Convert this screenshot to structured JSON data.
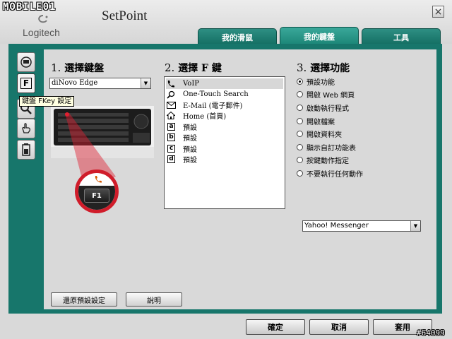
{
  "watermark": "MOBILE01",
  "post_id": "#64099",
  "brand": "Logitech",
  "app_title": "SetPoint",
  "close_glyph": "×",
  "tabs": [
    {
      "label": "我的滑鼠",
      "active": false
    },
    {
      "label": "我的鍵盤",
      "active": true
    },
    {
      "label": "工具",
      "active": false
    }
  ],
  "side_icons": [
    "keyboard-icon",
    "fkey-icon",
    "zoom-icon",
    "hand-icon",
    "battery-icon"
  ],
  "side_fkey_label": "F",
  "tooltip": "鍵盤 FKey 設定",
  "section1": {
    "num": "1.",
    "title": "選擇鍵盤"
  },
  "section2": {
    "num": "2.",
    "title": "選擇 F 鍵"
  },
  "section3": {
    "num": "3.",
    "title": "選擇功能"
  },
  "keyboard_select": {
    "value": "diNovo Edge"
  },
  "fkey_badge": "F1",
  "fkeys": [
    {
      "icon": "phone-icon",
      "glyph": "",
      "label": "VoIP",
      "selected": true
    },
    {
      "icon": "search-icon",
      "glyph": "",
      "label": "One-Touch Search",
      "selected": false
    },
    {
      "icon": "mail-icon",
      "glyph": "",
      "label": "E-Mail (電子郵件)",
      "selected": false
    },
    {
      "icon": "home-icon",
      "glyph": "",
      "label": "Home (首頁)",
      "selected": false
    },
    {
      "icon": "letter-a-icon",
      "glyph": "a",
      "label": "預設",
      "selected": false
    },
    {
      "icon": "letter-b-icon",
      "glyph": "b",
      "label": "預設",
      "selected": false
    },
    {
      "icon": "letter-c-icon",
      "glyph": "c",
      "label": "預設",
      "selected": false
    },
    {
      "icon": "letter-d-icon",
      "glyph": "d",
      "label": "預設",
      "selected": false
    }
  ],
  "functions": [
    {
      "label": "預設功能",
      "selected": true
    },
    {
      "label": "開啟 Web 網頁",
      "selected": false
    },
    {
      "label": "啟動執行程式",
      "selected": false
    },
    {
      "label": "開啟檔案",
      "selected": false
    },
    {
      "label": "開啟資料夾",
      "selected": false
    },
    {
      "label": "顯示自訂功能表",
      "selected": false
    },
    {
      "label": "按鍵動作指定",
      "selected": false
    },
    {
      "label": "不要執行任何動作",
      "selected": false
    }
  ],
  "app_select": {
    "value": "Yahoo! Messenger"
  },
  "buttons": {
    "restore": "還原預設設定",
    "help": "說明"
  },
  "footer": {
    "ok": "確定",
    "cancel": "取消",
    "apply": "套用"
  },
  "colors": {
    "accent": "#17766b",
    "tab": "#136d62",
    "highlight": "#e02030"
  }
}
